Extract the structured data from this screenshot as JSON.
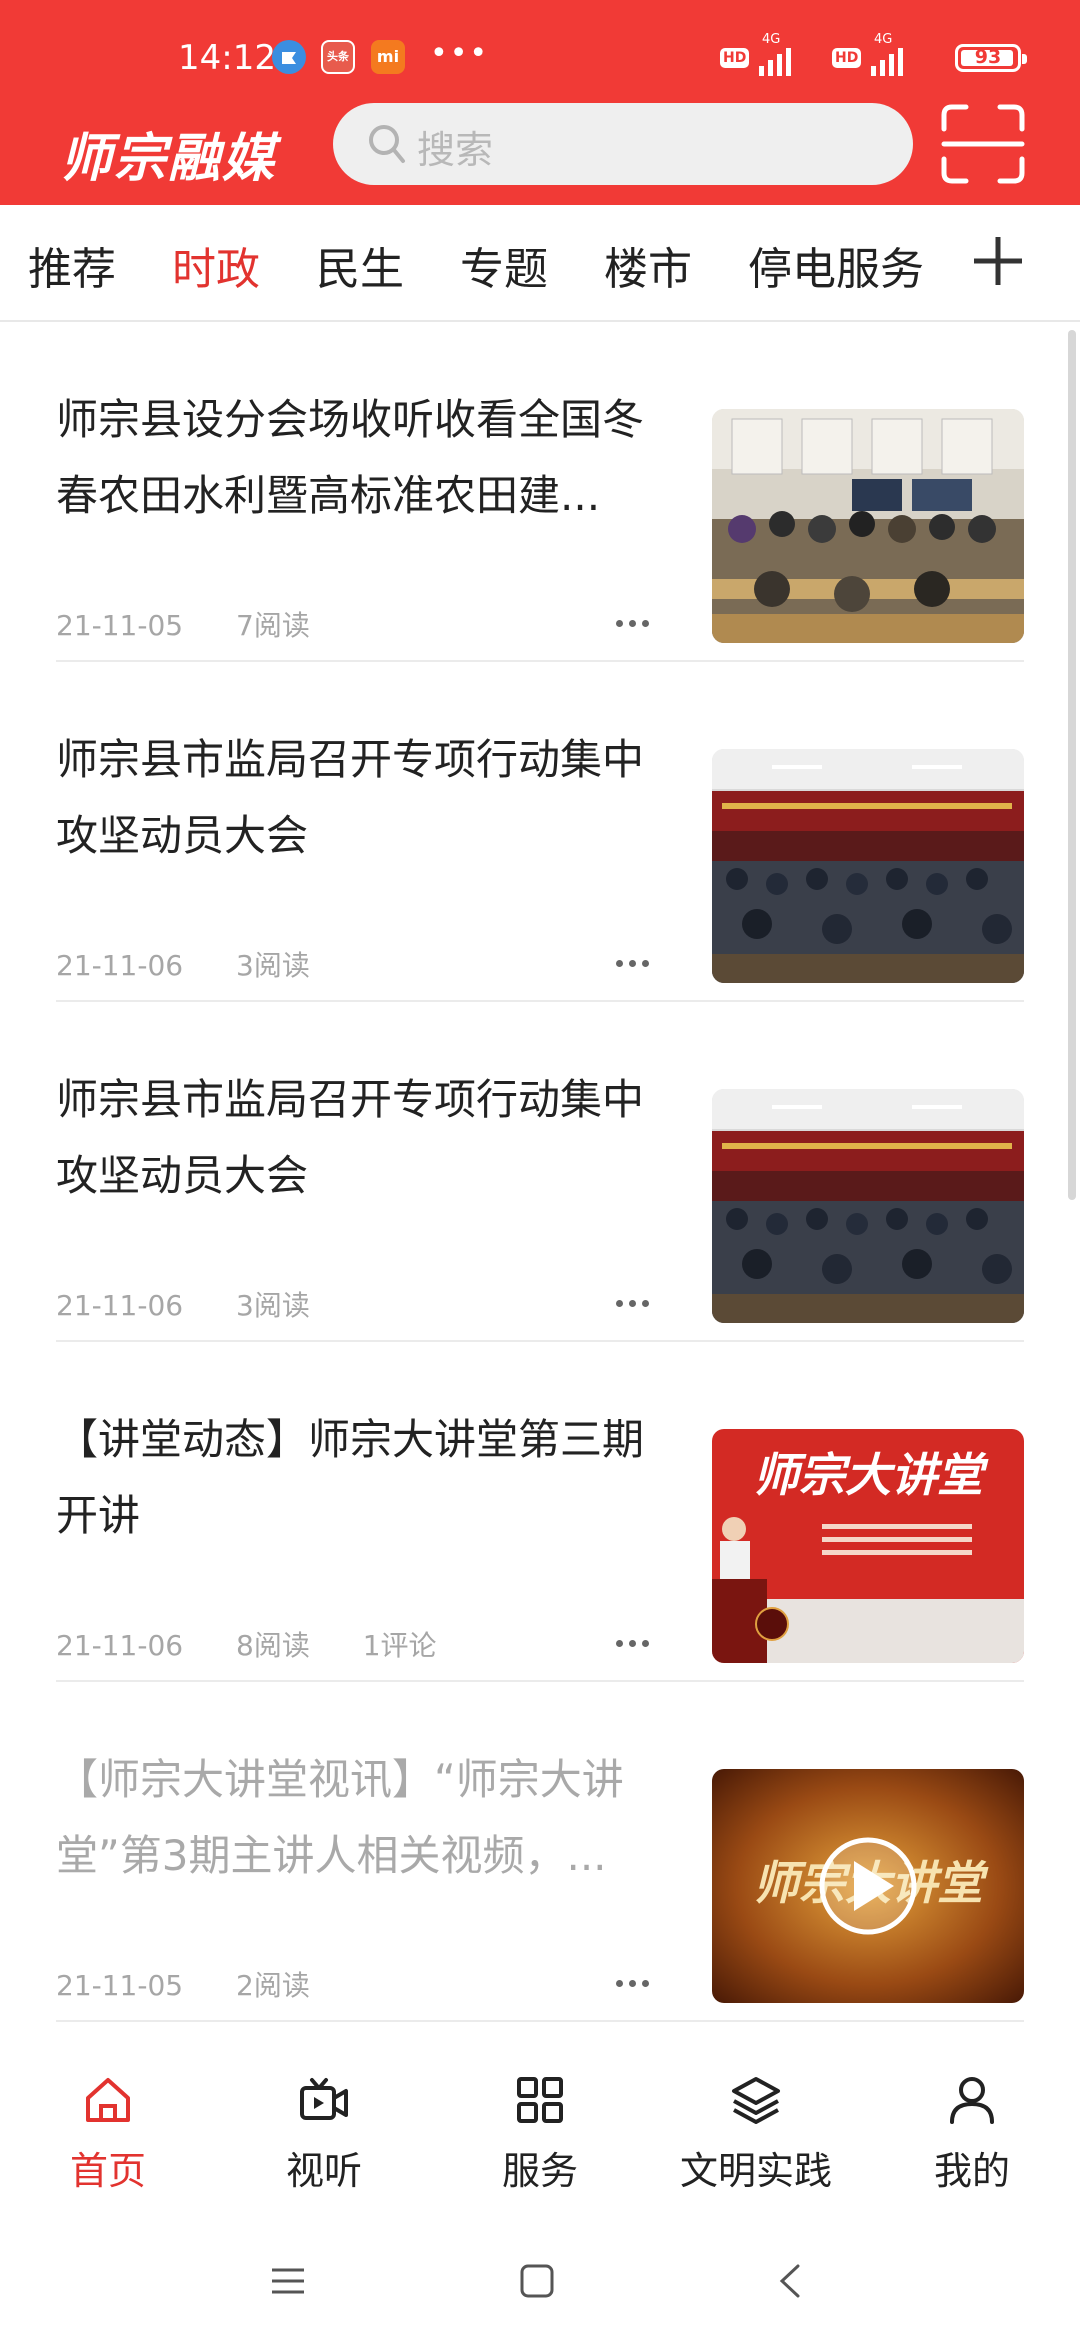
{
  "status_bar": {
    "time": "14:12",
    "notif_icons": [
      "app-icon-blue",
      "toutiao-icon",
      "mi-icon"
    ],
    "toutiao_label": "头条",
    "mi_label": "mi",
    "more": "•••",
    "network_1": "HD",
    "network_1_type": "4G",
    "network_2": "HD",
    "network_2_type": "4G",
    "battery": "93"
  },
  "header": {
    "logo": "师宗融媒",
    "search_placeholder": "搜索",
    "accent": "#f13a36"
  },
  "tabs": {
    "items": [
      "推荐",
      "时政",
      "民生",
      "专题",
      "楼市",
      "停电服务"
    ],
    "active_index": 1,
    "add": "+"
  },
  "articles": [
    {
      "title": "师宗县设分会场收听收看全国冬春农田水利暨高标准农田建...",
      "date": "21-11-05",
      "reads": "7阅读",
      "comments": "",
      "thumb": "meeting-room-photo",
      "read_state": "unread"
    },
    {
      "title": "师宗县市监局召开专项行动集中攻坚动员大会",
      "date": "21-11-06",
      "reads": "3阅读",
      "comments": "",
      "thumb": "conference-hall-photo",
      "read_state": "unread"
    },
    {
      "title": "师宗县市监局召开专项行动集中攻坚动员大会",
      "date": "21-11-06",
      "reads": "3阅读",
      "comments": "",
      "thumb": "conference-hall-photo",
      "read_state": "unread"
    },
    {
      "title": "【讲堂动态】师宗大讲堂第三期开讲",
      "date": "21-11-06",
      "reads": "8阅读",
      "comments": "1评论",
      "thumb": "lecture-stage-photo",
      "thumb_text": "师宗大讲堂",
      "read_state": "unread"
    },
    {
      "title": "【师宗大讲堂视讯】“师宗大讲堂”第3期主讲人相关视频，...",
      "date": "21-11-05",
      "reads": "2阅读",
      "comments": "",
      "thumb": "video-cover-photo",
      "thumb_text": "师宗大讲堂",
      "read_state": "read"
    }
  ],
  "bottom_nav": {
    "items": [
      {
        "label": "首页",
        "icon": "home-icon"
      },
      {
        "label": "视听",
        "icon": "video-icon"
      },
      {
        "label": "服务",
        "icon": "grid-icon"
      },
      {
        "label": "文明实践",
        "icon": "layers-icon"
      },
      {
        "label": "我的",
        "icon": "user-icon"
      }
    ],
    "active_index": 0
  },
  "system_nav": [
    "menu-icon",
    "home-square-icon",
    "back-icon"
  ]
}
